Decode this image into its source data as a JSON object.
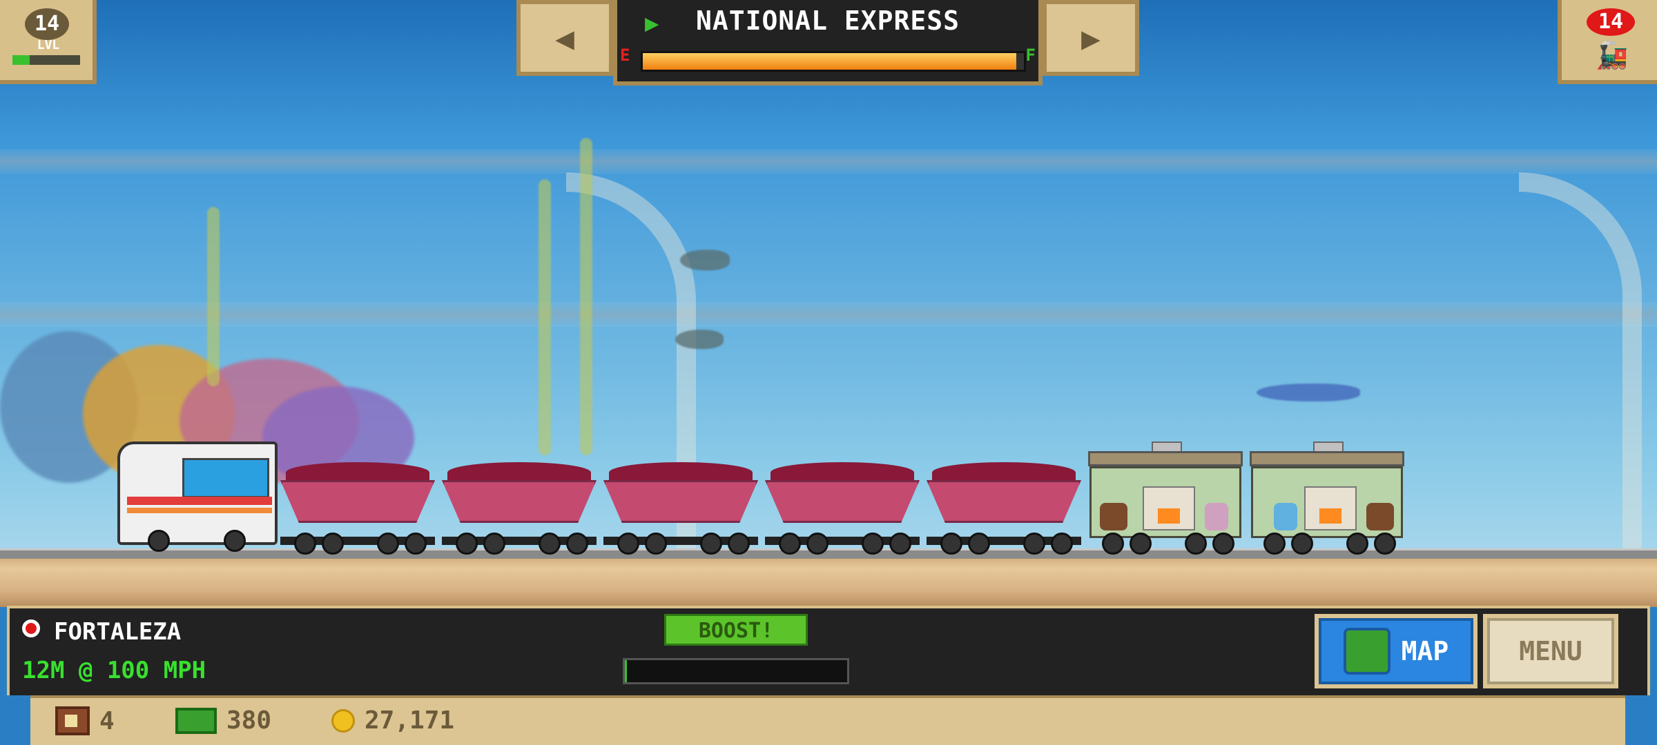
{
  "hud_top": {
    "level_value": "14",
    "level_label": "LVL",
    "level_progress": 0.25,
    "train_name": "NATIONAL EXPRESS",
    "prev_arrow": "◀",
    "next_arrow": "▶",
    "fuel_empty_label": "E",
    "fuel_full_label": "F",
    "fuel_level": 0.98,
    "train_count": "14"
  },
  "status": {
    "station": "FORTALEZA",
    "speed_text": "12M @ 100 MPH",
    "boost_label": "BOOST!",
    "boost_progress": 0.01
  },
  "buttons": {
    "map_label": "MAP",
    "menu_label": "MENU"
  },
  "resources": {
    "crates": "4",
    "cash": "380",
    "coins": "27,171"
  },
  "icons": {
    "level": "level-badge-icon",
    "train_select": "train-icon",
    "station": "station-marker-icon",
    "map": "globe-icon",
    "crate": "crate-icon",
    "cash": "cash-icon",
    "coin": "coin-icon"
  },
  "colors": {
    "accent_green": "#39c02f",
    "fuel_orange": "#f08010",
    "alert_red": "#e01818",
    "panel_tan": "#dcc592",
    "map_blue": "#2a86e0"
  }
}
